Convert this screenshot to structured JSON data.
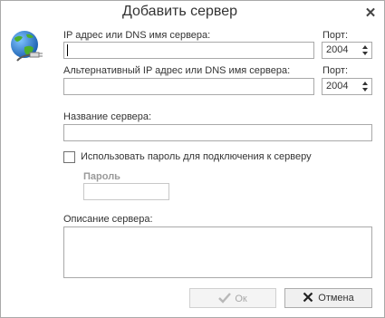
{
  "dialog": {
    "title": "Добавить сервер",
    "close_icon": "close-icon",
    "globe_icon": "globe-network-icon"
  },
  "server": {
    "label": "IP адрес или DNS имя сервера:",
    "value": "",
    "port_label": "Порт:",
    "port_value": "2004"
  },
  "alt_server": {
    "label": "Альтернативный IP адрес или DNS имя сервера:",
    "value": "",
    "port_label": "Порт:",
    "port_value": "2004"
  },
  "name": {
    "label": "Название сервера:",
    "value": ""
  },
  "use_password": {
    "label": "Использовать пароль для подключения к серверу",
    "checked": false
  },
  "password": {
    "label": "Пароль",
    "value": ""
  },
  "description": {
    "label": "Описание сервера:",
    "value": ""
  },
  "buttons": {
    "ok_label": "Ок",
    "ok_icon": "checkmark-icon",
    "cancel_label": "Отмена",
    "cancel_icon": "x-icon"
  },
  "colors": {
    "ok_check_disabled": "#b8b8b8",
    "cancel_x": "#222222",
    "globe_blue": "#1e73c8",
    "globe_green": "#4caf2a"
  }
}
